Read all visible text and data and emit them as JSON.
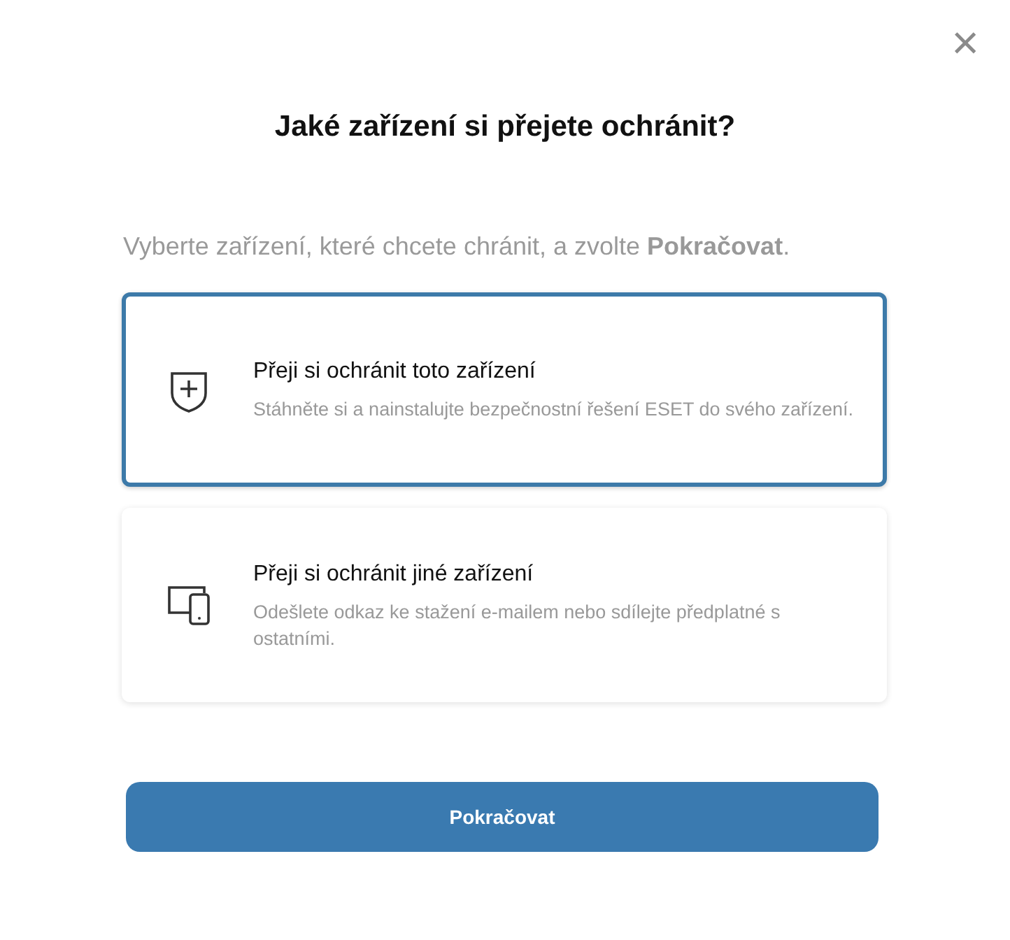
{
  "close_button": {
    "label": "×"
  },
  "title": "Jaké zařízení si přejete ochránit?",
  "instruction": "Vyberte zařízení, které chcete chránit, a zvolte **Pokračovat**.",
  "options": [
    {
      "kind": "shield",
      "title": "Přeji si ochránit toto zařízení",
      "description": "Stáhněte si a nainstalujte bezpečnostní řešení ESET do svého zařízení.",
      "selected": true
    },
    {
      "kind": "devices",
      "title": "Přeji si ochránit jiné zařízení",
      "description": "Odešlete odkaz ke stažení e-mailem nebo sdílejte předplatné s ostatními.",
      "selected": false
    }
  ],
  "continue_button": {
    "label": "Pokračovat"
  }
}
